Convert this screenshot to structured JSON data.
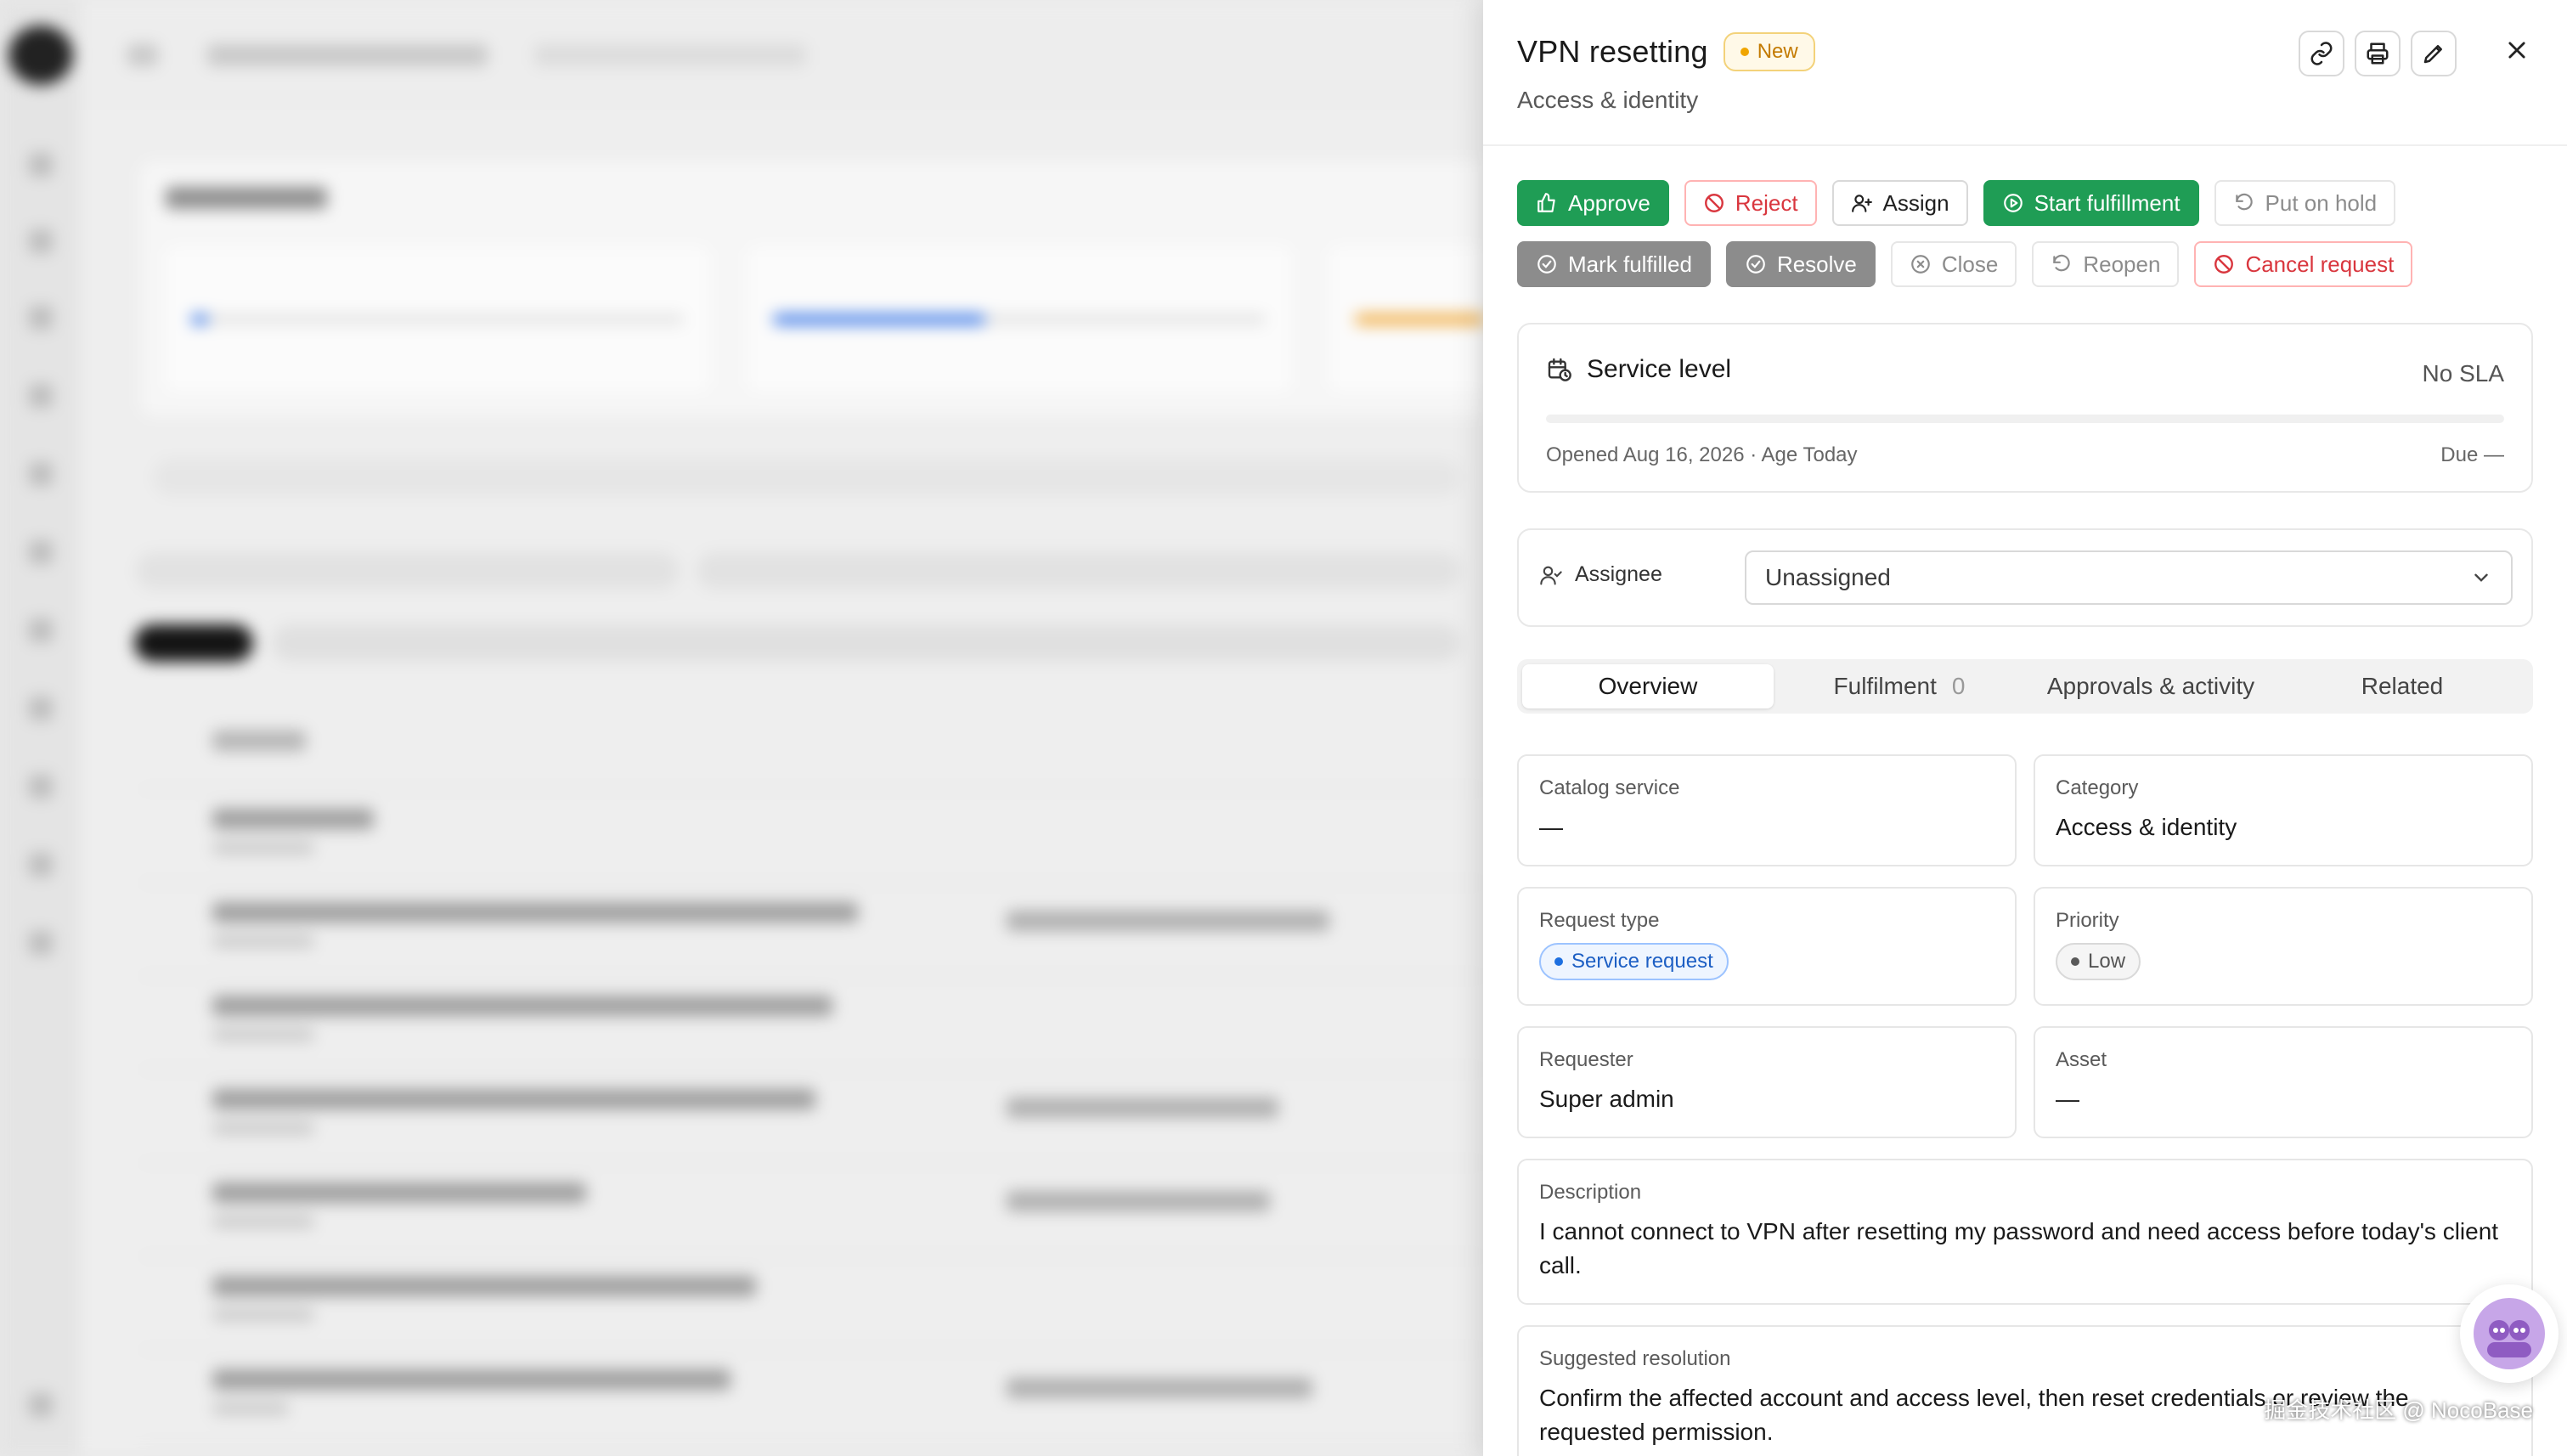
{
  "background": {
    "description_hidden": true
  },
  "drawer": {
    "title": "VPN resetting",
    "status": "New",
    "subtitle": "Access & identity",
    "header_actions": [
      {
        "icon": "link-icon"
      },
      {
        "icon": "print-icon"
      },
      {
        "icon": "edit-icon"
      }
    ],
    "close_icon": "close-icon",
    "actions_row1": [
      {
        "label": "Approve",
        "icon": "thumbs-up-icon",
        "style": "green"
      },
      {
        "label": "Reject",
        "icon": "ban-icon",
        "style": "danger"
      },
      {
        "label": "Assign",
        "icon": "user-plus-icon",
        "style": "default"
      },
      {
        "label": "Start fulfillment",
        "icon": "play-circle-icon",
        "style": "green"
      },
      {
        "label": "Put on hold",
        "icon": "undo-icon",
        "style": "muted"
      }
    ],
    "actions_row2": [
      {
        "label": "Mark fulfilled",
        "icon": "check-circle-icon",
        "style": "grey"
      },
      {
        "label": "Resolve",
        "icon": "check-circle-icon",
        "style": "grey"
      },
      {
        "label": "Close",
        "icon": "close-circle-icon",
        "style": "muted"
      },
      {
        "label": "Reopen",
        "icon": "undo-icon",
        "style": "muted"
      },
      {
        "label": "Cancel request",
        "icon": "ban-icon",
        "style": "danger"
      }
    ],
    "sla": {
      "title": "Service level",
      "value": "No SLA",
      "opened": "Opened Aug 16, 2026 · Age Today",
      "due": "Due —"
    },
    "assignee": {
      "label": "Assignee",
      "value": "Unassigned"
    },
    "tabs": [
      {
        "label": "Overview",
        "count": ""
      },
      {
        "label": "Fulfilment",
        "count": "0"
      },
      {
        "label": "Approvals & activity",
        "count": ""
      },
      {
        "label": "Related",
        "count": ""
      }
    ],
    "fields": {
      "catalog_service": {
        "label": "Catalog service",
        "value": "—"
      },
      "category": {
        "label": "Category",
        "value": "Access & identity"
      },
      "request_type": {
        "label": "Request type",
        "value": "Service request"
      },
      "priority": {
        "label": "Priority",
        "value": "Low"
      },
      "requester": {
        "label": "Requester",
        "value": "Super admin"
      },
      "asset": {
        "label": "Asset",
        "value": "—"
      },
      "description": {
        "label": "Description",
        "value": "I cannot connect to VPN after resetting my password and need access before today's client call."
      },
      "suggested_resolution": {
        "label": "Suggested resolution",
        "value": "Confirm the affected account and access level, then reset credentials or review the requested permission."
      }
    }
  },
  "watermark": "掘金技术社区 @ NocoBase",
  "colors": {
    "green": "#1f9d55",
    "danger": "#d9363e",
    "status_new": "#f0a500",
    "tag_blue": "#1d6fe0"
  }
}
